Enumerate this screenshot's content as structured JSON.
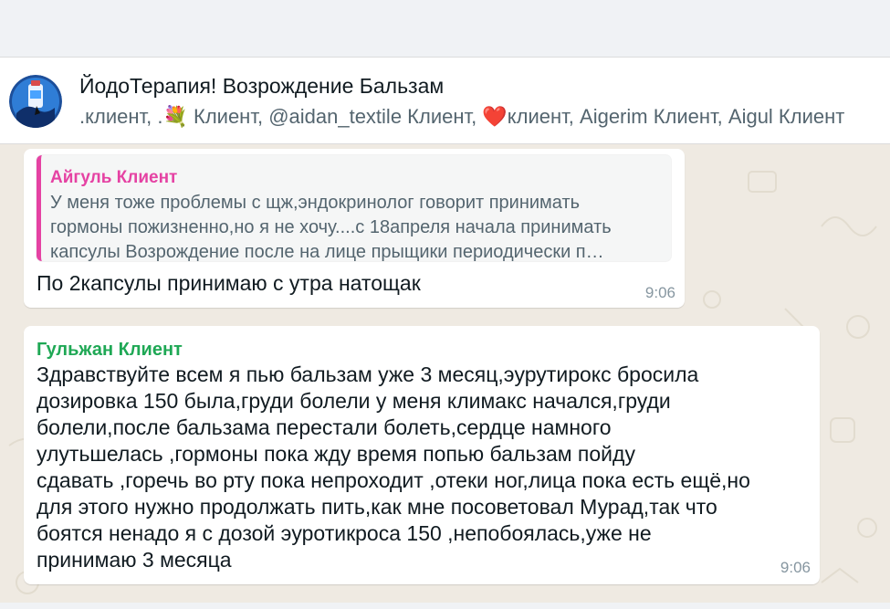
{
  "header": {
    "title": "ЙодоТерапия! Возрождение Бальзам",
    "subtitle_parts": [
      ".клиент, .",
      "💐",
      " Клиент, @aidan_textile Клиент, ",
      "❤️",
      "клиент, Aigerim Клиент, Aigul Клиент"
    ],
    "avatar_icon": "group-avatar-icon"
  },
  "messages": [
    {
      "quote": {
        "author": "Айгуль Клиент",
        "author_color": "#e542a3",
        "lines": [
          "У меня тоже проблемы с щж,эндокринолог говорит принимать",
          "гормоны пожизненно,но я не хочу....с 18апреля начала принимать",
          "капсулы Возрождение после на лице прыщики периодически п…"
        ]
      },
      "text": "По 2капсулы принимаю с утра натощак",
      "time": "9:06"
    },
    {
      "author": "Гульжан Клиент",
      "author_color": "#1fa855",
      "lines": [
        "Здравствуйте всем я пью бальзам уже 3 месяц,эурутирокс бросила",
        "дозировка 150 была,груди болели у меня климакс начался,груди",
        "болели,после бальзама перестали болеть,сердце намного",
        "улутьшелась ,гормоны пока жду время попью бальзам пойду",
        "сдавать ,горечь во рту пока непроходит ,отеки ног,лица пока есть ещё,но",
        "для этого нужно продолжать пить,как мне посоветовал Мурад,так что",
        "боятся ненадо я с дозой эуротикроса 150 ,непобоялась,уже не",
        "принимаю 3 месяца"
      ],
      "time": "9:06"
    }
  ],
  "colors": {
    "wallpaper": "#efeae2",
    "bubble": "#ffffff",
    "header": "#ffffff"
  }
}
